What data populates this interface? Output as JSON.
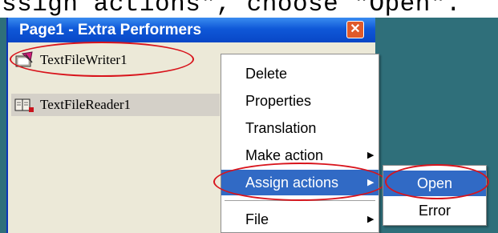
{
  "caption": {
    "text": "ssign actions\", choose \"Open\"."
  },
  "window": {
    "title": "Page1 - Extra Performers",
    "close_symbol": "✕",
    "title_color": "#0846c6"
  },
  "list": {
    "items": [
      {
        "label": "TextFileWriter1",
        "icon": "text-file-writer-icon"
      },
      {
        "label": "TextFileReader1",
        "icon": "text-file-reader-icon"
      }
    ]
  },
  "context_menu": {
    "items": [
      {
        "label": "Delete",
        "has_submenu": false
      },
      {
        "label": "Properties",
        "has_submenu": false
      },
      {
        "label": "Translation",
        "has_submenu": false
      },
      {
        "label": "Make action",
        "has_submenu": true
      },
      {
        "label": "Assign actions",
        "has_submenu": true,
        "highlighted": true
      },
      {
        "label": "File",
        "has_submenu": true
      }
    ],
    "arrow": "▶",
    "highlight_color": "#316ac5"
  },
  "submenu": {
    "items": [
      {
        "label": "Open",
        "highlighted": true
      },
      {
        "label": "Error",
        "highlighted": false
      }
    ]
  },
  "annotation_color": "#d8141c"
}
